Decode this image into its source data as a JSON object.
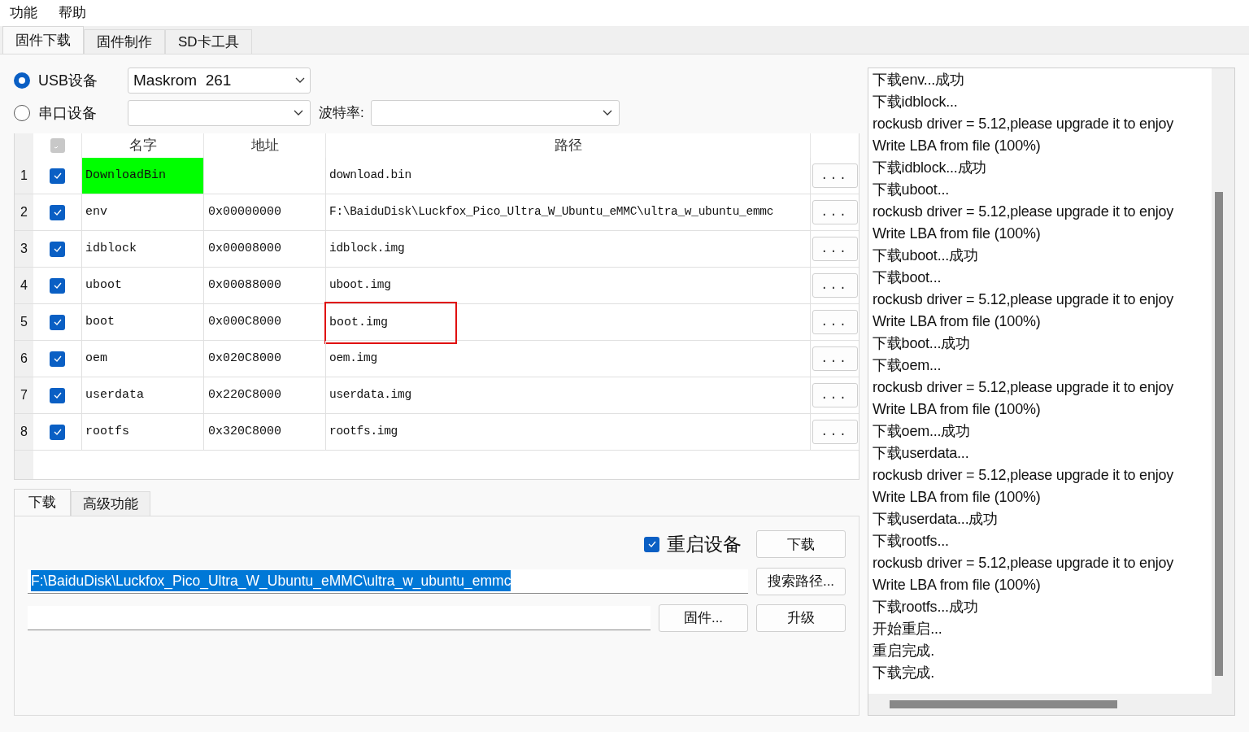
{
  "menu": [
    "功能",
    "帮助"
  ],
  "tabs": [
    {
      "label": "固件下载",
      "selected": true
    },
    {
      "label": "固件制作",
      "selected": false
    },
    {
      "label": "SD卡工具",
      "selected": false
    }
  ],
  "usb": {
    "label": "USB设备",
    "selected": true,
    "value": "Maskrom  261"
  },
  "serial": {
    "label": "串口设备",
    "selected": false,
    "baud_label": "波特率:"
  },
  "table": {
    "columns": [
      "名字",
      "地址",
      "路径"
    ],
    "header_checked": false,
    "rows": [
      {
        "index": "1",
        "checked": true,
        "name": "DownloadBin",
        "address": "",
        "path": "download.bin",
        "name_highlighted": true,
        "path_marked": false,
        "browse": "..."
      },
      {
        "index": "2",
        "checked": true,
        "name": "env",
        "address": "0x00000000",
        "path": "F:\\BaiduDisk\\Luckfox_Pico_Ultra_W_Ubuntu_eMMC\\ultra_w_ubuntu_emmc",
        "name_highlighted": false,
        "path_marked": false,
        "browse": "..."
      },
      {
        "index": "3",
        "checked": true,
        "name": "idblock",
        "address": "0x00008000",
        "path": "idblock.img",
        "name_highlighted": false,
        "path_marked": false,
        "browse": "..."
      },
      {
        "index": "4",
        "checked": true,
        "name": "uboot",
        "address": "0x00088000",
        "path": "uboot.img",
        "name_highlighted": false,
        "path_marked": false,
        "browse": "..."
      },
      {
        "index": "5",
        "checked": true,
        "name": "boot",
        "address": "0x000C8000",
        "path": "boot.img",
        "name_highlighted": false,
        "path_marked": true,
        "browse": "..."
      },
      {
        "index": "6",
        "checked": true,
        "name": "oem",
        "address": "0x020C8000",
        "path": "oem.img",
        "name_highlighted": false,
        "path_marked": false,
        "browse": "..."
      },
      {
        "index": "7",
        "checked": true,
        "name": "userdata",
        "address": "0x220C8000",
        "path": "userdata.img",
        "name_highlighted": false,
        "path_marked": false,
        "browse": "..."
      },
      {
        "index": "8",
        "checked": true,
        "name": "rootfs",
        "address": "0x320C8000",
        "path": "rootfs.img",
        "name_highlighted": false,
        "path_marked": false,
        "browse": "..."
      }
    ]
  },
  "bottom_tabs": [
    {
      "label": "下载",
      "selected": true
    },
    {
      "label": "高级功能",
      "selected": false
    }
  ],
  "reboot": {
    "label": "重启设备",
    "checked": true
  },
  "buttons": {
    "download": "下载",
    "search_path": "搜索路径...",
    "firmware": "固件...",
    "upgrade": "升级"
  },
  "path_field": {
    "value": "F:\\BaiduDisk\\Luckfox_Pico_Ultra_W_Ubuntu_eMMC\\ultra_w_ubuntu_emmc",
    "selected": true
  },
  "log": [
    "下载env...成功",
    "下载idblock...",
    "rockusb driver = 5.12,please upgrade it to enjoy",
    "Write LBA from file (100%)",
    "下载idblock...成功",
    "下载uboot...",
    "rockusb driver = 5.12,please upgrade it to enjoy",
    "Write LBA from file (100%)",
    "下载uboot...成功",
    "下载boot...",
    "rockusb driver = 5.12,please upgrade it to enjoy",
    "Write LBA from file (100%)",
    "下载boot...成功",
    "下载oem...",
    "rockusb driver = 5.12,please upgrade it to enjoy",
    "Write LBA from file (100%)",
    "下载oem...成功",
    "下载userdata...",
    "rockusb driver = 5.12,please upgrade it to enjoy",
    "Write LBA from file (100%)",
    "下载userdata...成功",
    "下载rootfs...",
    "rockusb driver = 5.12,please upgrade it to enjoy",
    "Write LBA from file (100%)",
    "下载rootfs...成功",
    "开始重启...",
    "重启完成.",
    "下载完成."
  ]
}
